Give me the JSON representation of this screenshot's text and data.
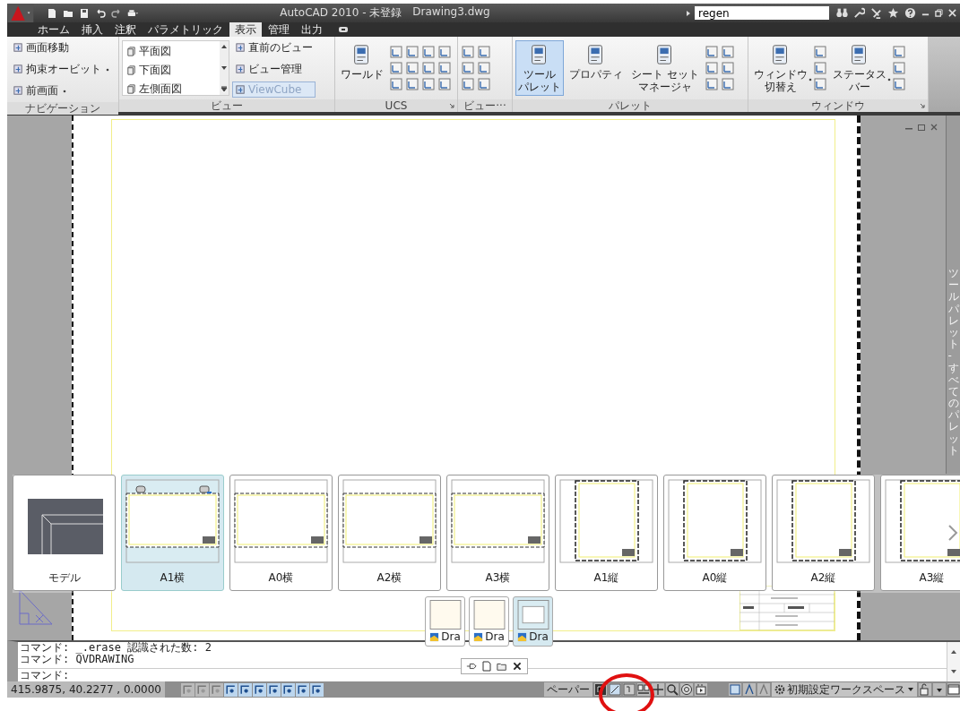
{
  "title_bar": {
    "title": "AutoCAD 2010 - 未登録",
    "document": "Drawing3.dwg",
    "search_value": "regen"
  },
  "ribbon_tabs": [
    {
      "label": "ホーム",
      "selected": false
    },
    {
      "label": "挿入",
      "selected": false
    },
    {
      "label": "注釈",
      "selected": false
    },
    {
      "label": "パラメトリック",
      "selected": false
    },
    {
      "label": "表示",
      "selected": true
    },
    {
      "label": "管理",
      "selected": false
    },
    {
      "label": "出力",
      "selected": false
    }
  ],
  "ribbon_panels": [
    {
      "title": "ナビゲーション",
      "launcher": false,
      "groups": [
        {
          "kind": "small_list",
          "items": [
            {
              "label": "画面移動",
              "dropdown": false,
              "disabled": false
            },
            {
              "label": "拘束オービット",
              "dropdown": true,
              "disabled": false
            },
            {
              "label": "前画面",
              "dropdown": true,
              "disabled": false
            }
          ]
        }
      ]
    },
    {
      "title": "ビュー",
      "launcher": false,
      "groups": [
        {
          "kind": "listbox",
          "items": [
            {
              "label": "平面図"
            },
            {
              "label": "下面図"
            },
            {
              "label": "左側面図"
            }
          ]
        },
        {
          "kind": "small_list",
          "items": [
            {
              "label": "直前のビュー",
              "dropdown": false,
              "disabled": false
            },
            {
              "label": "ビュー管理",
              "dropdown": false,
              "disabled": false
            },
            {
              "label": "ViewCube",
              "dropdown": false,
              "disabled": true
            }
          ]
        }
      ]
    },
    {
      "title": "UCS",
      "launcher": true,
      "groups": [
        {
          "kind": "large",
          "lines": [
            "ワールド"
          ],
          "selected": false,
          "dropdown": false
        },
        {
          "kind": "grid4"
        }
      ]
    },
    {
      "title": "ビュー···",
      "launcher": false,
      "groups": [
        {
          "kind": "grid2"
        }
      ]
    },
    {
      "title": "パレット",
      "launcher": false,
      "groups": [
        {
          "kind": "large",
          "lines": [
            "ツール",
            "パレット"
          ],
          "selected": true,
          "dropdown": false
        },
        {
          "kind": "large",
          "lines": [
            "プロパティ"
          ],
          "selected": false,
          "dropdown": false
        },
        {
          "kind": "large",
          "lines": [
            "シート セット",
            "マネージャ"
          ],
          "selected": false,
          "dropdown": false
        },
        {
          "kind": "grid2"
        }
      ]
    },
    {
      "title": "ウィンドウ",
      "launcher": true,
      "groups": [
        {
          "kind": "large",
          "lines": [
            "ウィンドウ",
            "切替え"
          ],
          "selected": false,
          "dropdown": true
        },
        {
          "kind": "column"
        },
        {
          "kind": "large",
          "lines": [
            "ステータス",
            "バー"
          ],
          "selected": false,
          "dropdown": true
        },
        {
          "kind": "column"
        }
      ]
    }
  ],
  "palette_title": "ツールパレット - すべてのパレット",
  "layouts": [
    {
      "label": "モデル",
      "kind": "model",
      "selected": false
    },
    {
      "label": "A1横",
      "kind": "landscape",
      "selected": true
    },
    {
      "label": "A0横",
      "kind": "landscape",
      "selected": false
    },
    {
      "label": "A2横",
      "kind": "landscape",
      "selected": false
    },
    {
      "label": "A3横",
      "kind": "landscape",
      "selected": false
    },
    {
      "label": "A1縦",
      "kind": "portrait",
      "selected": false
    },
    {
      "label": "A0縦",
      "kind": "portrait",
      "selected": false
    },
    {
      "label": "A2縦",
      "kind": "portrait",
      "selected": false
    },
    {
      "label": "A3縦",
      "kind": "portrait",
      "selected": false
    }
  ],
  "drawings": [
    {
      "label": "Dra",
      "selected": false
    },
    {
      "label": "Dra",
      "selected": false
    },
    {
      "label": "Dra",
      "selected": true
    }
  ],
  "command_lines": [
    "コマンド: _.erase 認識された数: 2",
    "コマンド: QVDRAWING"
  ],
  "command_prompt": "コマンド:",
  "status_bar": {
    "coordinates": "415.9875, 40.2277 , 0.0000",
    "toggles": [
      {
        "on": false
      },
      {
        "on": false
      },
      {
        "on": false
      },
      {
        "on": true
      },
      {
        "on": true
      },
      {
        "on": true
      },
      {
        "on": true
      },
      {
        "on": true
      },
      {
        "on": true
      },
      {
        "on": true
      }
    ],
    "space": "ペーパー",
    "workspace": "初期設定ワークスペース"
  }
}
